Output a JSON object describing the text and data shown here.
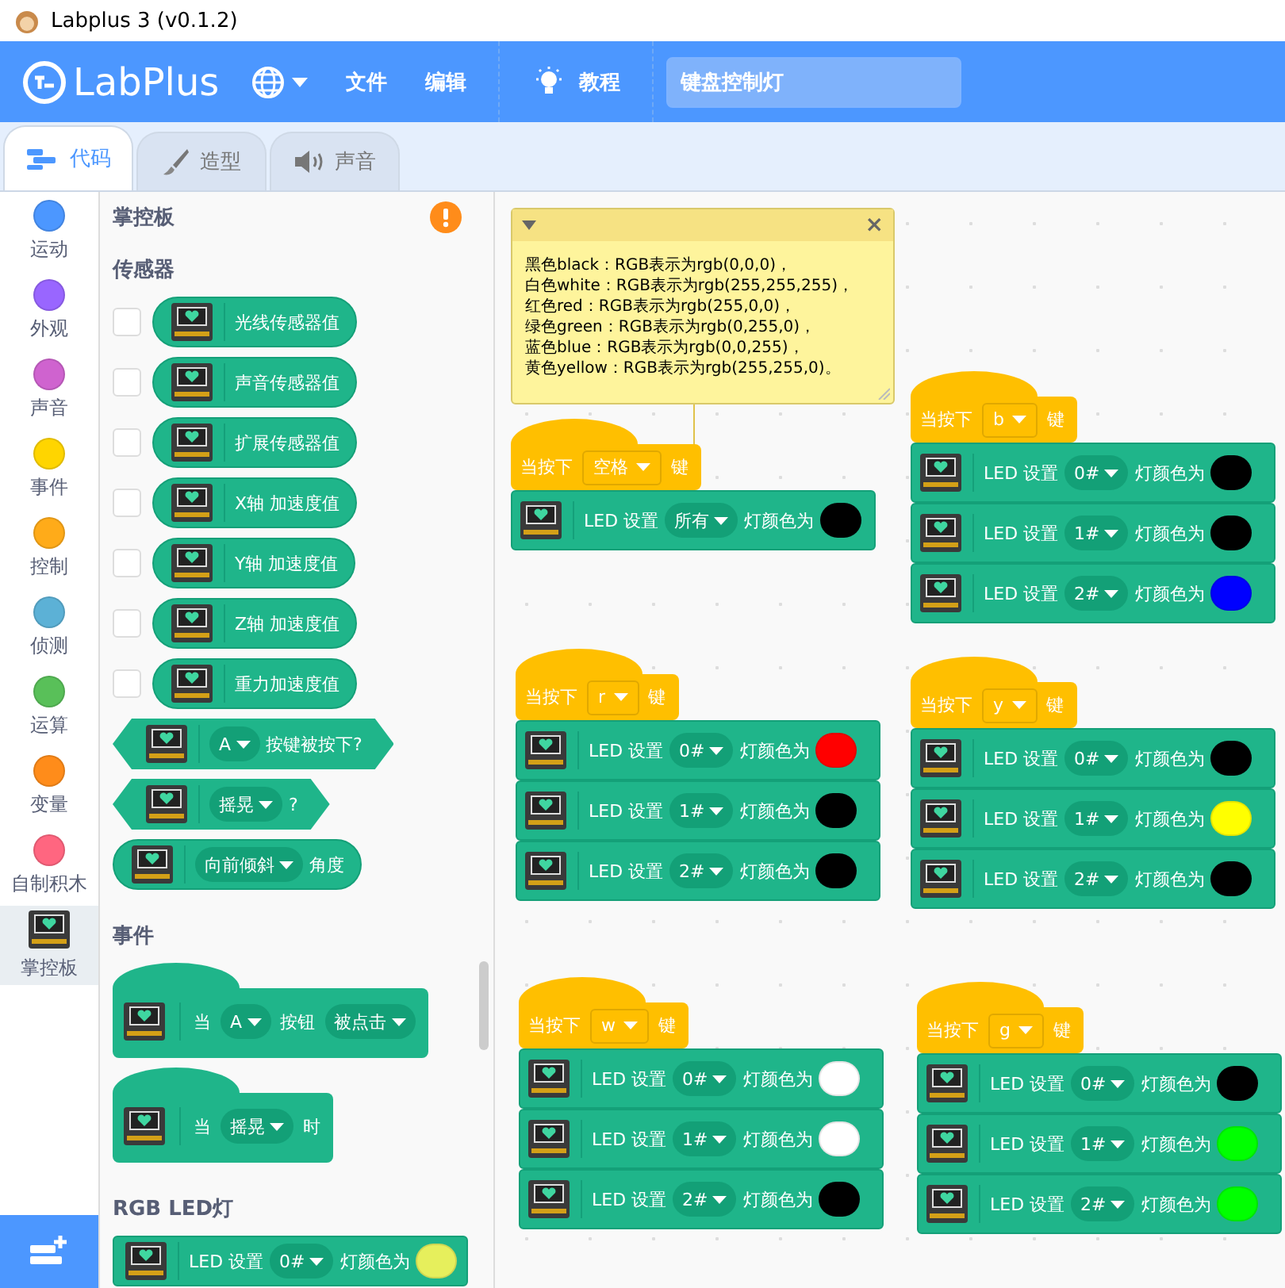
{
  "window": {
    "title": "Labplus 3 (v0.1.2)"
  },
  "menu_bar": {
    "logo": "LabPlus",
    "items": [
      "文件",
      "编辑"
    ],
    "tutorial": "教程",
    "project_title": "键盘控制灯"
  },
  "tabs": [
    {
      "label": "代码",
      "selected": true
    },
    {
      "label": "造型",
      "selected": false
    },
    {
      "label": "声音",
      "selected": false
    }
  ],
  "categories": [
    {
      "kind": "dot",
      "label": "运动",
      "color": "#4c97ff",
      "selected": false
    },
    {
      "kind": "dot",
      "label": "外观",
      "color": "#9966ff",
      "selected": false
    },
    {
      "kind": "dot",
      "label": "声音",
      "color": "#cf63cf",
      "selected": false
    },
    {
      "kind": "dot",
      "label": "事件",
      "color": "#ffd500",
      "selected": false
    },
    {
      "kind": "dot",
      "label": "控制",
      "color": "#ffab19",
      "selected": false
    },
    {
      "kind": "dot",
      "label": "侦测",
      "color": "#5cb1d6",
      "selected": false
    },
    {
      "kind": "dot",
      "label": "运算",
      "color": "#59c059",
      "selected": false
    },
    {
      "kind": "dot",
      "label": "变量",
      "color": "#ff8c1a",
      "selected": false
    },
    {
      "kind": "dot",
      "label": "自制积木",
      "color": "#ff6680",
      "selected": false
    },
    {
      "kind": "board",
      "label": "掌控板",
      "selected": true
    }
  ],
  "palette": {
    "title": "掌控板",
    "sections": [
      {
        "title": "传感器",
        "blocks": [
          {
            "kind": "reporter",
            "checked": false,
            "parts": [
              {
                "kind": "text",
                "text": "光线传感器值"
              }
            ]
          },
          {
            "kind": "reporter",
            "checked": false,
            "parts": [
              {
                "kind": "text",
                "text": "声音传感器值"
              }
            ]
          },
          {
            "kind": "reporter",
            "checked": false,
            "parts": [
              {
                "kind": "text",
                "text": "扩展传感器值"
              }
            ]
          },
          {
            "kind": "reporter",
            "checked": false,
            "parts": [
              {
                "kind": "text",
                "text": "X轴 加速度值"
              }
            ]
          },
          {
            "kind": "reporter",
            "checked": false,
            "parts": [
              {
                "kind": "text",
                "text": "Y轴 加速度值"
              }
            ]
          },
          {
            "kind": "reporter",
            "checked": false,
            "parts": [
              {
                "kind": "text",
                "text": "Z轴 加速度值"
              }
            ]
          },
          {
            "kind": "reporter",
            "checked": false,
            "parts": [
              {
                "kind": "text",
                "text": "重力加速度值"
              }
            ]
          },
          {
            "kind": "boolean",
            "parts": [
              {
                "kind": "dropdown",
                "text": "A"
              },
              {
                "kind": "text",
                "text": "按键被按下?"
              }
            ]
          },
          {
            "kind": "boolean",
            "parts": [
              {
                "kind": "dropdown",
                "text": "摇晃"
              },
              {
                "kind": "text",
                "text": "?"
              }
            ]
          },
          {
            "kind": "reporter",
            "parts": [
              {
                "kind": "dropdown",
                "text": "向前倾斜"
              },
              {
                "kind": "text",
                "text": "角度"
              }
            ]
          }
        ]
      },
      {
        "title": "事件",
        "blocks": [
          {
            "kind": "hat",
            "parts": [
              {
                "kind": "text",
                "text": "当"
              },
              {
                "kind": "dropdown",
                "text": "A"
              },
              {
                "kind": "text",
                "text": "按钮"
              },
              {
                "kind": "dropdown",
                "text": "被点击"
              }
            ]
          },
          {
            "kind": "hat",
            "parts": [
              {
                "kind": "text",
                "text": "当"
              },
              {
                "kind": "dropdown",
                "text": "摇晃"
              },
              {
                "kind": "text",
                "text": "时"
              }
            ]
          }
        ]
      },
      {
        "title": "RGB LED灯",
        "blocks": [
          {
            "kind": "command",
            "parts": [
              {
                "kind": "text",
                "text": "LED 设置"
              },
              {
                "kind": "dropdown",
                "text": "0#"
              },
              {
                "kind": "text",
                "text": "灯颜色为"
              },
              {
                "kind": "color",
                "color": "#e6ef5c"
              }
            ]
          }
        ]
      }
    ]
  },
  "canvas": {
    "comment": {
      "close": "×",
      "lines": [
        "黑色black：RGB表示为rgb(0,0,0)，",
        "白色white：RGB表示为rgb(255,255,255)，",
        "红色red：RGB表示为rgb(255,0,0)，",
        "绿色green：RGB表示为rgb(0,255,0)，",
        "蓝色blue：RGB表示为rgb(0,0,255)，",
        "黄色yellow：RGB表示为rgb(255,255,0)。"
      ]
    },
    "scripts": [
      {
        "hat": {
          "prefix": "当按下",
          "key": "空格",
          "suffix": "键"
        },
        "leds": [
          {
            "label": "LED 设置",
            "slot": "所有",
            "suffix": "灯颜色为",
            "color": "#000000"
          }
        ]
      },
      {
        "hat": {
          "prefix": "当按下",
          "key": "r",
          "suffix": "键"
        },
        "leds": [
          {
            "label": "LED 设置",
            "slot": "0#",
            "suffix": "灯颜色为",
            "color": "#ff0000"
          },
          {
            "label": "LED 设置",
            "slot": "1#",
            "suffix": "灯颜色为",
            "color": "#000000"
          },
          {
            "label": "LED 设置",
            "slot": "2#",
            "suffix": "灯颜色为",
            "color": "#000000"
          }
        ]
      },
      {
        "hat": {
          "prefix": "当按下",
          "key": "w",
          "suffix": "键"
        },
        "leds": [
          {
            "label": "LED 设置",
            "slot": "0#",
            "suffix": "灯颜色为",
            "color": "#ffffff"
          },
          {
            "label": "LED 设置",
            "slot": "1#",
            "suffix": "灯颜色为",
            "color": "#ffffff"
          },
          {
            "label": "LED 设置",
            "slot": "2#",
            "suffix": "灯颜色为",
            "color": "#000000"
          }
        ]
      },
      {
        "hat": {
          "prefix": "当按下",
          "key": "b",
          "suffix": "键"
        },
        "leds": [
          {
            "label": "LED 设置",
            "slot": "0#",
            "suffix": "灯颜色为",
            "color": "#000000"
          },
          {
            "label": "LED 设置",
            "slot": "1#",
            "suffix": "灯颜色为",
            "color": "#000000"
          },
          {
            "label": "LED 设置",
            "slot": "2#",
            "suffix": "灯颜色为",
            "color": "#0000ff"
          }
        ]
      },
      {
        "hat": {
          "prefix": "当按下",
          "key": "y",
          "suffix": "键"
        },
        "leds": [
          {
            "label": "LED 设置",
            "slot": "0#",
            "suffix": "灯颜色为",
            "color": "#000000"
          },
          {
            "label": "LED 设置",
            "slot": "1#",
            "suffix": "灯颜色为",
            "color": "#ffff00"
          },
          {
            "label": "LED 设置",
            "slot": "2#",
            "suffix": "灯颜色为",
            "color": "#000000"
          }
        ]
      },
      {
        "hat": {
          "prefix": "当按下",
          "key": "g",
          "suffix": "键"
        },
        "leds": [
          {
            "label": "LED 设置",
            "slot": "0#",
            "suffix": "灯颜色为",
            "color": "#000000"
          },
          {
            "label": "LED 设置",
            "slot": "1#",
            "suffix": "灯颜色为",
            "color": "#00ff00"
          },
          {
            "label": "LED 设置",
            "slot": "2#",
            "suffix": "灯颜色为",
            "color": "#00ff00"
          }
        ]
      }
    ]
  }
}
